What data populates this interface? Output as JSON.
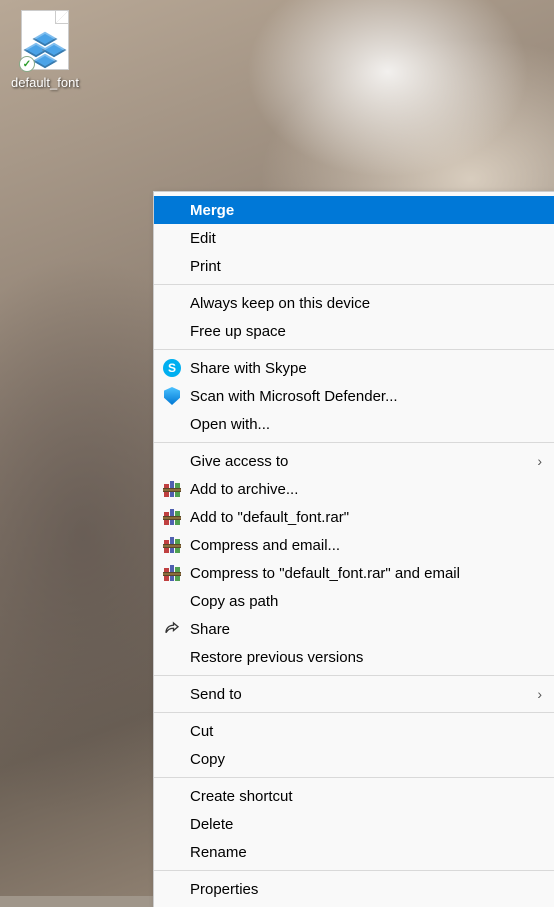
{
  "desktop": {
    "icon_label": "default_font"
  },
  "menu": {
    "groups": [
      [
        {
          "id": "merge",
          "label": "Merge",
          "bold": true,
          "highlighted": true,
          "icon": null,
          "submenu": false
        },
        {
          "id": "edit",
          "label": "Edit",
          "bold": false,
          "highlighted": false,
          "icon": null,
          "submenu": false
        },
        {
          "id": "print",
          "label": "Print",
          "bold": false,
          "highlighted": false,
          "icon": null,
          "submenu": false
        }
      ],
      [
        {
          "id": "always-keep",
          "label": "Always keep on this device",
          "bold": false,
          "highlighted": false,
          "icon": null,
          "submenu": false
        },
        {
          "id": "free-up",
          "label": "Free up space",
          "bold": false,
          "highlighted": false,
          "icon": null,
          "submenu": false
        }
      ],
      [
        {
          "id": "share-skype",
          "label": "Share with Skype",
          "bold": false,
          "highlighted": false,
          "icon": "skype",
          "submenu": false
        },
        {
          "id": "scan-defender",
          "label": "Scan with Microsoft Defender...",
          "bold": false,
          "highlighted": false,
          "icon": "defender",
          "submenu": false
        },
        {
          "id": "open-with",
          "label": "Open with...",
          "bold": false,
          "highlighted": false,
          "icon": null,
          "submenu": false
        }
      ],
      [
        {
          "id": "give-access",
          "label": "Give access to",
          "bold": false,
          "highlighted": false,
          "icon": null,
          "submenu": true
        },
        {
          "id": "add-archive",
          "label": "Add to archive...",
          "bold": false,
          "highlighted": false,
          "icon": "winrar",
          "submenu": false
        },
        {
          "id": "add-default-rar",
          "label": "Add to \"default_font.rar\"",
          "bold": false,
          "highlighted": false,
          "icon": "winrar",
          "submenu": false
        },
        {
          "id": "compress-email",
          "label": "Compress and email...",
          "bold": false,
          "highlighted": false,
          "icon": "winrar",
          "submenu": false
        },
        {
          "id": "compress-default-email",
          "label": "Compress to \"default_font.rar\" and email",
          "bold": false,
          "highlighted": false,
          "icon": "winrar",
          "submenu": false
        },
        {
          "id": "copy-path",
          "label": "Copy as path",
          "bold": false,
          "highlighted": false,
          "icon": null,
          "submenu": false
        },
        {
          "id": "share",
          "label": "Share",
          "bold": false,
          "highlighted": false,
          "icon": "share",
          "submenu": false
        },
        {
          "id": "restore-versions",
          "label": "Restore previous versions",
          "bold": false,
          "highlighted": false,
          "icon": null,
          "submenu": false
        }
      ],
      [
        {
          "id": "send-to",
          "label": "Send to",
          "bold": false,
          "highlighted": false,
          "icon": null,
          "submenu": true
        }
      ],
      [
        {
          "id": "cut",
          "label": "Cut",
          "bold": false,
          "highlighted": false,
          "icon": null,
          "submenu": false
        },
        {
          "id": "copy",
          "label": "Copy",
          "bold": false,
          "highlighted": false,
          "icon": null,
          "submenu": false
        }
      ],
      [
        {
          "id": "create-shortcut",
          "label": "Create shortcut",
          "bold": false,
          "highlighted": false,
          "icon": null,
          "submenu": false
        },
        {
          "id": "delete",
          "label": "Delete",
          "bold": false,
          "highlighted": false,
          "icon": null,
          "submenu": false
        },
        {
          "id": "rename",
          "label": "Rename",
          "bold": false,
          "highlighted": false,
          "icon": null,
          "submenu": false
        }
      ],
      [
        {
          "id": "properties",
          "label": "Properties",
          "bold": false,
          "highlighted": false,
          "icon": null,
          "submenu": false
        }
      ]
    ]
  }
}
